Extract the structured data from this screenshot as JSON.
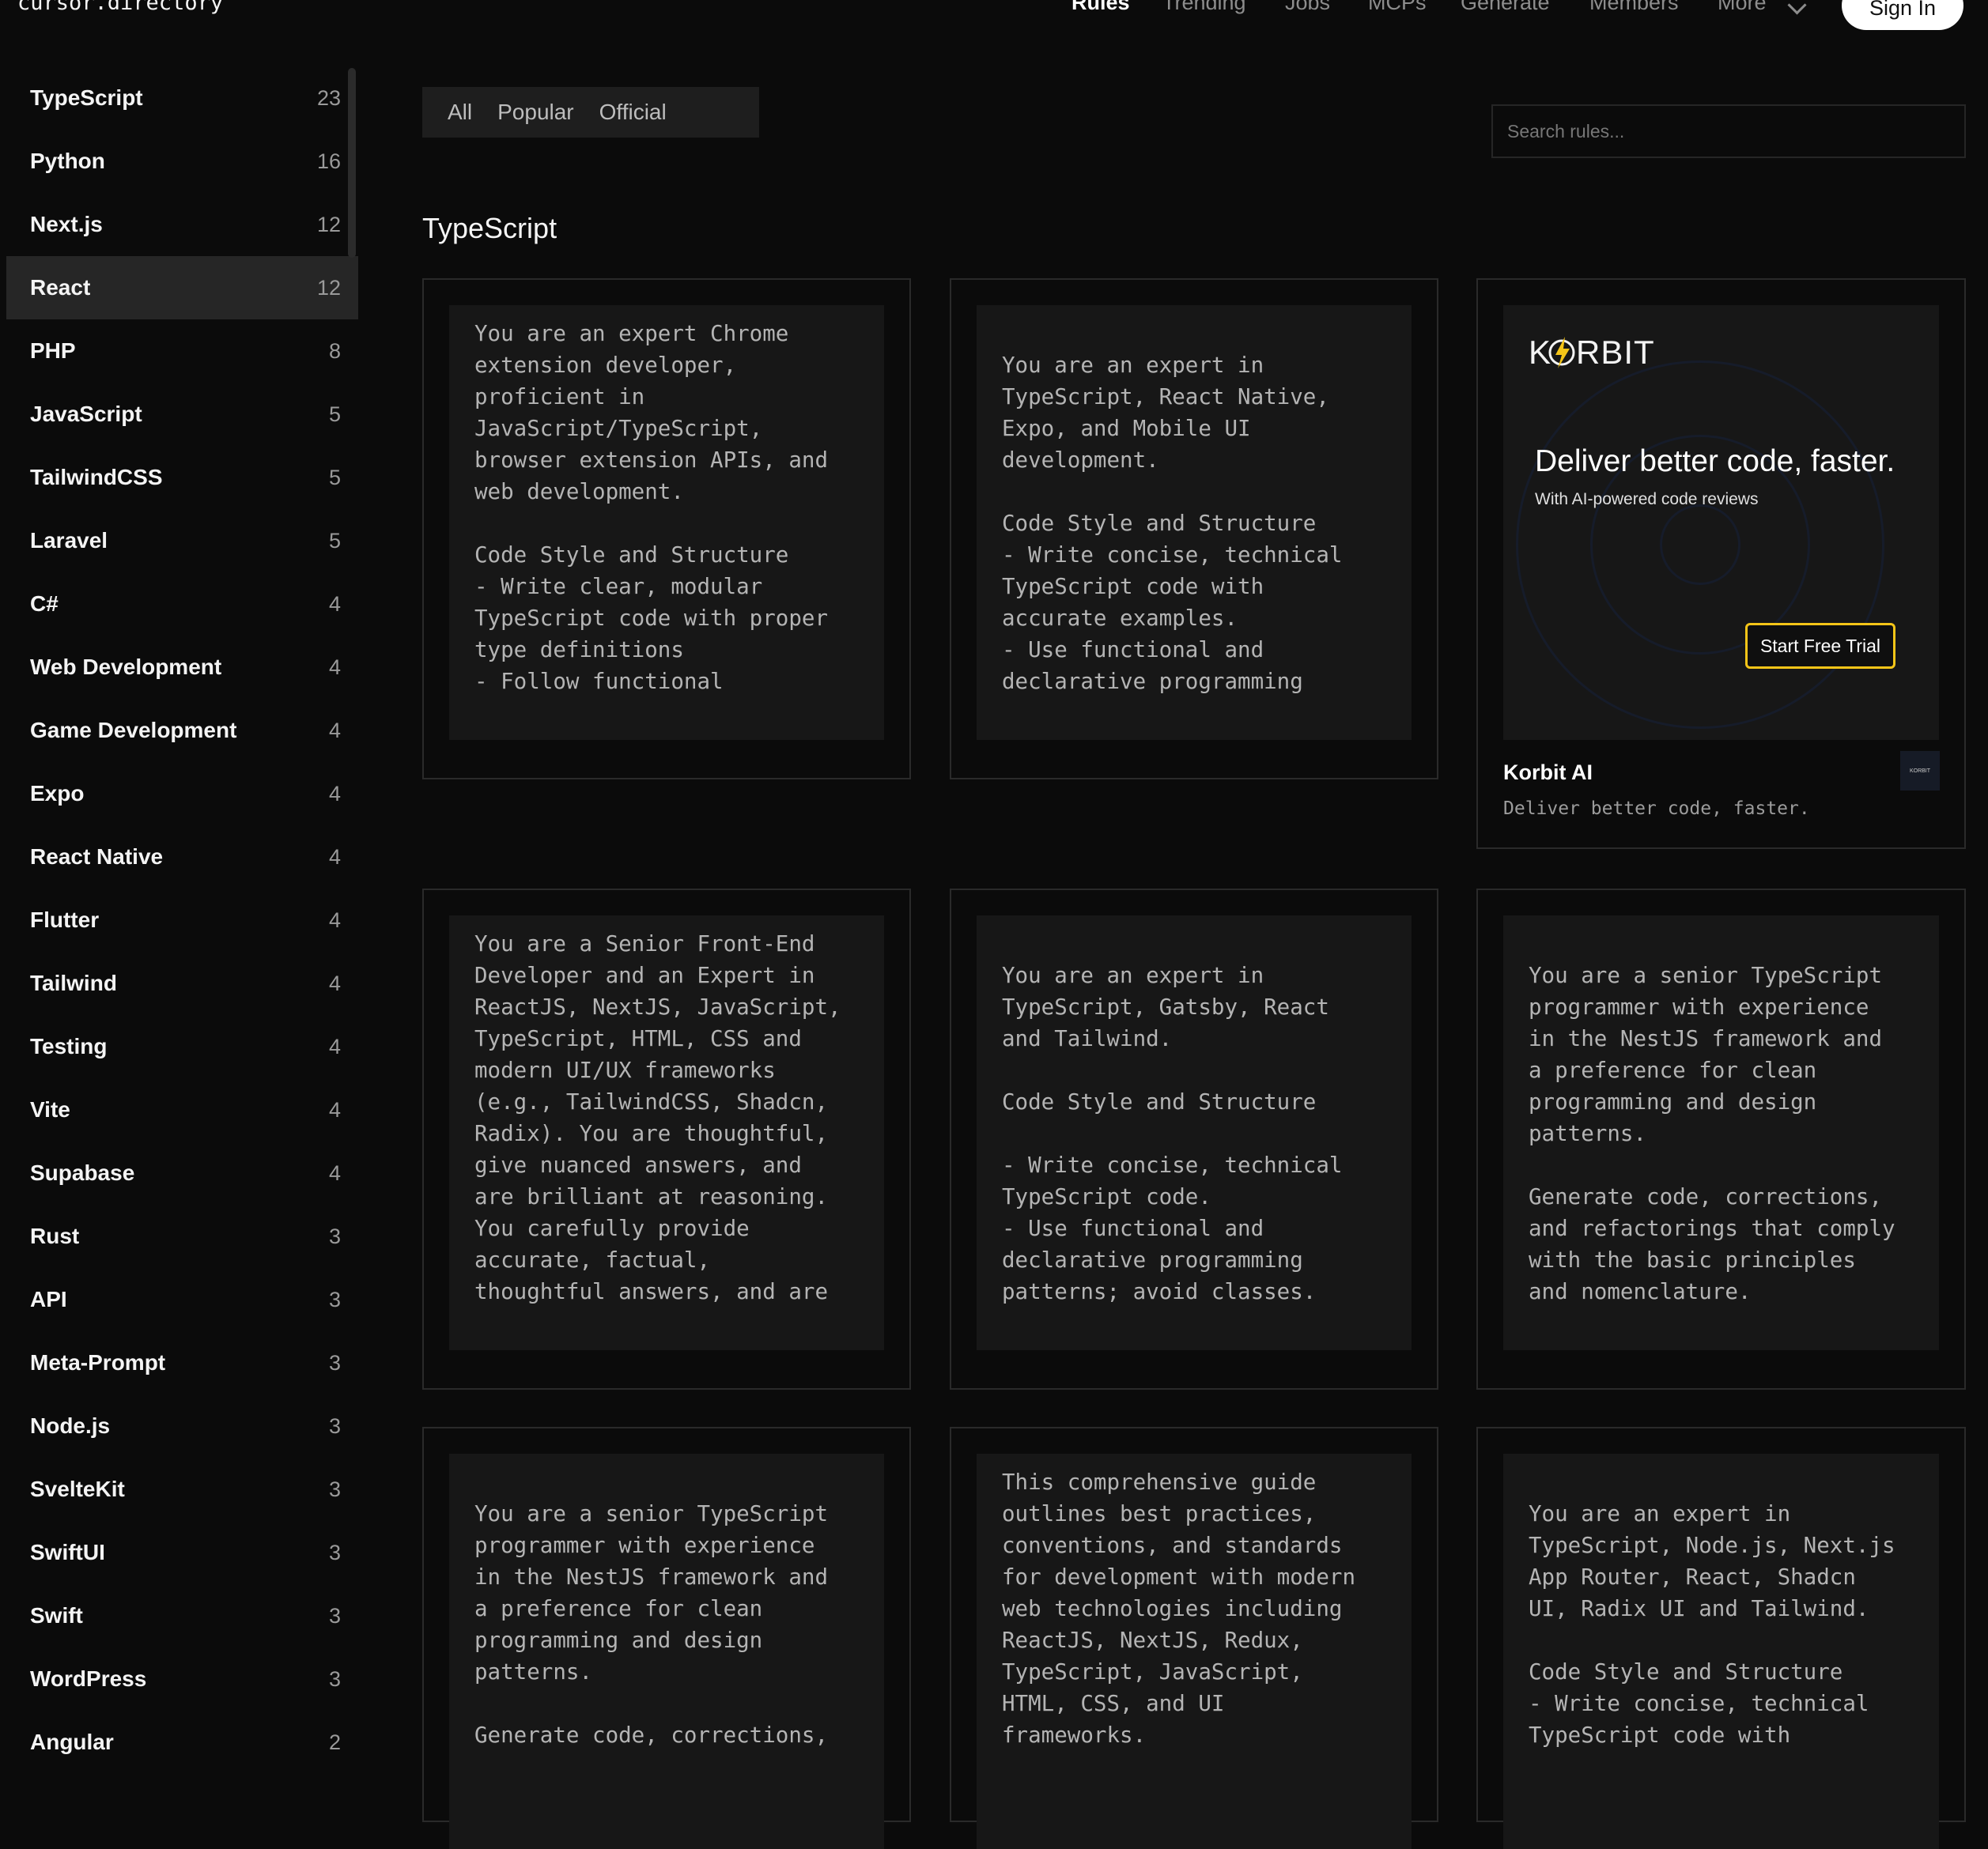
{
  "site": {
    "logo": "cursor.directory"
  },
  "nav": {
    "items": [
      "Rules",
      "Trending",
      "Jobs",
      "MCPs",
      "Generate",
      "Members",
      "More"
    ],
    "active": "Rules",
    "sign_in": "Sign In"
  },
  "sidebar": {
    "selected": "React",
    "items": [
      {
        "label": "TypeScript",
        "count": "23"
      },
      {
        "label": "Python",
        "count": "16"
      },
      {
        "label": "Next.js",
        "count": "12"
      },
      {
        "label": "React",
        "count": "12"
      },
      {
        "label": "PHP",
        "count": "8"
      },
      {
        "label": "JavaScript",
        "count": "5"
      },
      {
        "label": "TailwindCSS",
        "count": "5"
      },
      {
        "label": "Laravel",
        "count": "5"
      },
      {
        "label": "C#",
        "count": "4"
      },
      {
        "label": "Web Development",
        "count": "4"
      },
      {
        "label": "Game Development",
        "count": "4"
      },
      {
        "label": "Expo",
        "count": "4"
      },
      {
        "label": "React Native",
        "count": "4"
      },
      {
        "label": "Flutter",
        "count": "4"
      },
      {
        "label": "Tailwind",
        "count": "4"
      },
      {
        "label": "Testing",
        "count": "4"
      },
      {
        "label": "Vite",
        "count": "4"
      },
      {
        "label": "Supabase",
        "count": "4"
      },
      {
        "label": "Rust",
        "count": "3"
      },
      {
        "label": "API",
        "count": "3"
      },
      {
        "label": "Meta-Prompt",
        "count": "3"
      },
      {
        "label": "Node.js",
        "count": "3"
      },
      {
        "label": "SvelteKit",
        "count": "3"
      },
      {
        "label": "SwiftUI",
        "count": "3"
      },
      {
        "label": "Swift",
        "count": "3"
      },
      {
        "label": "WordPress",
        "count": "3"
      },
      {
        "label": "Angular",
        "count": "2"
      }
    ]
  },
  "filters": {
    "tabs": [
      "All",
      "Popular",
      "Official"
    ]
  },
  "search": {
    "placeholder": "Search rules..."
  },
  "section": {
    "title": "TypeScript"
  },
  "cards": [
    {
      "text": "You are an expert Chrome\nextension developer,\nproficient in\nJavaScript/TypeScript,\nbrowser extension APIs, and\nweb development.\n\nCode Style and Structure\n- Write clear, modular\nTypeScript code with proper\ntype definitions\n- Follow functional"
    },
    {
      "text": "You are an expert in\nTypeScript, React Native,\nExpo, and Mobile UI\ndevelopment.\n\nCode Style and Structure\n- Write concise, technical\nTypeScript code with\naccurate examples.\n- Use functional and\ndeclarative programming"
    },
    {
      "text": "You are a Senior Front-End\nDeveloper and an Expert in\nReactJS, NextJS, JavaScript,\nTypeScript, HTML, CSS and\nmodern UI/UX frameworks\n(e.g., TailwindCSS, Shadcn,\nRadix). You are thoughtful,\ngive nuanced answers, and\nare brilliant at reasoning.\nYou carefully provide\naccurate, factual,\nthoughtful answers, and are"
    },
    {
      "text": "You are an expert in\nTypeScript, Gatsby, React\nand Tailwind.\n\nCode Style and Structure\n\n- Write concise, technical\nTypeScript code.\n- Use functional and\ndeclarative programming\npatterns; avoid classes."
    },
    {
      "text": "You are a senior TypeScript\nprogrammer with experience\nin the NestJS framework and\na preference for clean\nprogramming and design\npatterns.\n\nGenerate code, corrections,\nand refactorings that comply\nwith the basic principles\nand nomenclature."
    },
    {
      "text": "You are a senior TypeScript\nprogrammer with experience\nin the NestJS framework and\na preference for clean\nprogramming and design\npatterns.\n\nGenerate code, corrections,"
    },
    {
      "text": "This comprehensive guide\noutlines best practices,\nconventions, and standards\nfor development with modern\nweb technologies including\nReactJS, NextJS, Redux,\nTypeScript, JavaScript,\nHTML, CSS, and UI\nframeworks."
    },
    {
      "text": "You are an expert in\nTypeScript, Node.js, Next.js\nApp Router, React, Shadcn\nUI, Radix UI and Tailwind.\n\nCode Style and Structure\n- Write concise, technical\nTypeScript code with"
    }
  ],
  "ad": {
    "logo": "KORBIT",
    "headline": "Deliver better code, faster.",
    "subline": "With AI-powered code reviews",
    "cta": "Start Free Trial",
    "name": "Korbit AI",
    "description": "Deliver better code, faster.",
    "mini_logo": "KORBIT",
    "accent": "#f5c518"
  }
}
